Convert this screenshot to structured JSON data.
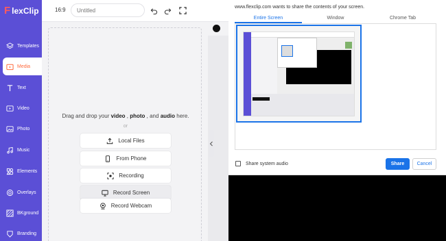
{
  "app": {
    "logo_mark": "F",
    "logo_text": "lexClip",
    "brand_color": "#5b4fd6",
    "accent_color": "#ff6a3d"
  },
  "sidebar": {
    "items": [
      {
        "label": "Templates",
        "icon": "layers-icon"
      },
      {
        "label": "Media",
        "icon": "media-folder-icon",
        "active": true
      },
      {
        "label": "Text",
        "icon": "text-icon"
      },
      {
        "label": "Video",
        "icon": "video-icon"
      },
      {
        "label": "Photo",
        "icon": "photo-icon"
      },
      {
        "label": "Music",
        "icon": "music-icon"
      },
      {
        "label": "Elements",
        "icon": "elements-icon"
      },
      {
        "label": "Overlays",
        "icon": "overlays-icon"
      },
      {
        "label": "BKground",
        "icon": "background-icon"
      },
      {
        "label": "Branding",
        "icon": "branding-icon"
      }
    ]
  },
  "toolbar": {
    "ratio": "16:9",
    "title_placeholder": "Untitled",
    "undo_icon": "undo-icon",
    "redo_icon": "redo-icon",
    "fit_icon": "fit-screen-icon"
  },
  "media_panel": {
    "drag_prefix": "Drag and drop your ",
    "drag_video": "video",
    "drag_sep1": " , ",
    "drag_photo": "photo",
    "drag_sep2": " , and ",
    "drag_audio": "audio",
    "drag_suffix": " here.",
    "or": "or",
    "sources": [
      {
        "label": "Local Files",
        "icon": "upload-icon"
      },
      {
        "label": "From Phone",
        "icon": "phone-icon"
      },
      {
        "label": "Recording",
        "icon": "recording-icon"
      },
      {
        "label": "Record Screen",
        "icon": "monitor-icon",
        "hover": true
      },
      {
        "label": "Record Webcam",
        "icon": "webcam-icon"
      }
    ]
  },
  "share_dialog": {
    "message": "www.flexclip.com wants to share the contents of your screen.",
    "tabs": [
      "Entire Screen",
      "Window",
      "Chrome Tab"
    ],
    "active_tab": "Entire Screen",
    "share_audio_label": "Share system audio",
    "share_label": "Share",
    "cancel_label": "Cancel"
  }
}
